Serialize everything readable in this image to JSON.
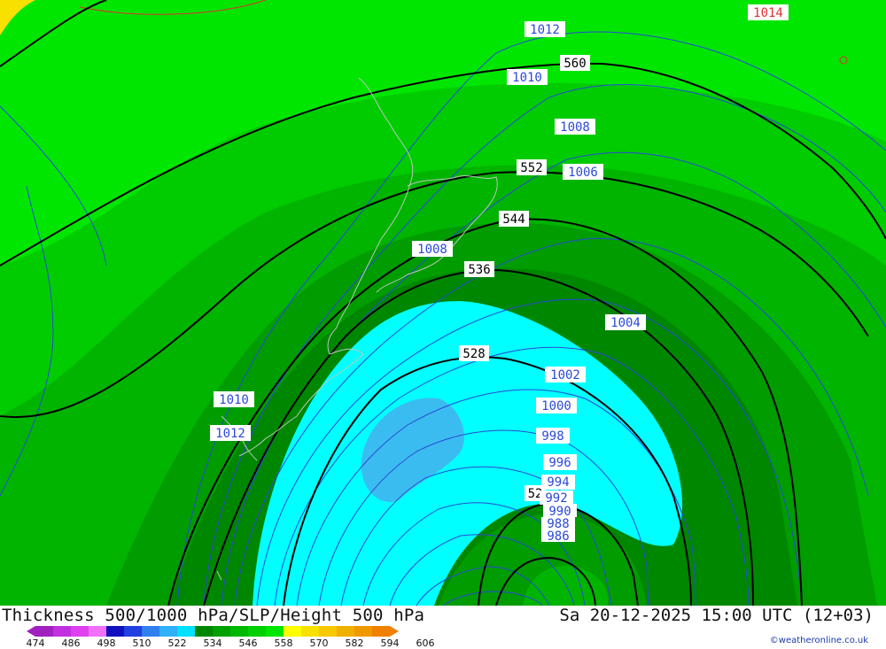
{
  "map": {
    "thickness_labels": [
      "560",
      "552",
      "544",
      "536",
      "528",
      "52"
    ],
    "isobar_labels": [
      "1014",
      "1012",
      "1010",
      "1008",
      "1006",
      "1008",
      "1004",
      "1002",
      "1000",
      "998",
      "996",
      "994",
      "992",
      "990",
      "988",
      "986",
      "1010",
      "1012"
    ],
    "colors": {
      "band_558": "#00e600",
      "band_552": "#00cc00",
      "band_546": "#00b400",
      "band_540": "#009c00",
      "band_534": "#008700",
      "band_522": "#00ffff",
      "band_516": "#3bbcf0",
      "isobar": "#2a4ad8",
      "thickness_line": "#000000",
      "high_isobar": "#e03030",
      "coastline": "#b8c8b8"
    }
  },
  "footer": {
    "title": "Thickness 500/1000 hPa/SLP/Height 500 hPa",
    "datetime": "Sa 20-12-2025 15:00 UTC (12+03)",
    "credit": "©weatheronline.co.uk",
    "legend_ticks": [
      "474",
      "486",
      "498",
      "510",
      "522",
      "534",
      "546",
      "558",
      "570",
      "582",
      "594",
      "606"
    ],
    "legend_colors": [
      "#a020c0",
      "#c030e0",
      "#e040f0",
      "#f070f8",
      "#1010c0",
      "#2040e0",
      "#3080f0",
      "#30b0f8",
      "#00e0ff",
      "#008700",
      "#00a000",
      "#00b800",
      "#00d000",
      "#00e600",
      "#ffff00",
      "#f8e000",
      "#f8c800",
      "#f0b000",
      "#f09800",
      "#f08000"
    ]
  }
}
